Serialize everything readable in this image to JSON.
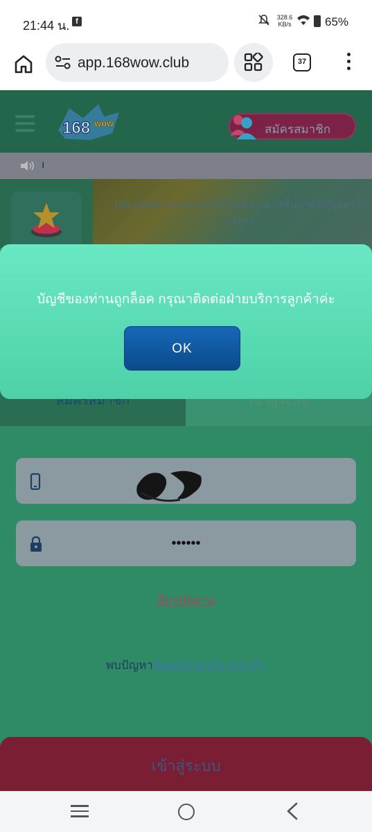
{
  "status_bar": {
    "time": "21:44 น.",
    "fb": "f",
    "speed": "328.6 KB/s",
    "battery": "65%"
  },
  "browser": {
    "url": "app.168wow.club",
    "tab_count": "37"
  },
  "site": {
    "logo_text": "168wow",
    "register_label": "สมัครสมาชิก",
    "marquee_text": "ı",
    "promo_text": "168 WOW รวบรวม คาสิโนสด ทุกค่ายชั้นนำที่ดีที่สุดมาให้บริการ"
  },
  "tabs": {
    "register": "สมัครสมาชิก",
    "login": "เข้าสู่ระบบ"
  },
  "form": {
    "phone_value": "",
    "password_value": "••••••",
    "forgot_password": "ลืมรหัสผ่าน",
    "problem_text": "พบปัญหา",
    "contact_link": "ติดต่อฝ่ายบริการลูกค้า",
    "login_button": "เข้าสู่ระบบ"
  },
  "modal": {
    "message": "บัญชีของท่านถูกล็อค กรุณาติดต่อฝ่ายบริการลูกค้าค่ะ",
    "ok_label": "OK"
  },
  "colors": {
    "modal_bg": "#5fdfb8",
    "ok_button": "#0f5aa6",
    "page_bg": "#2f8a66",
    "login_button": "#7a1e33"
  }
}
